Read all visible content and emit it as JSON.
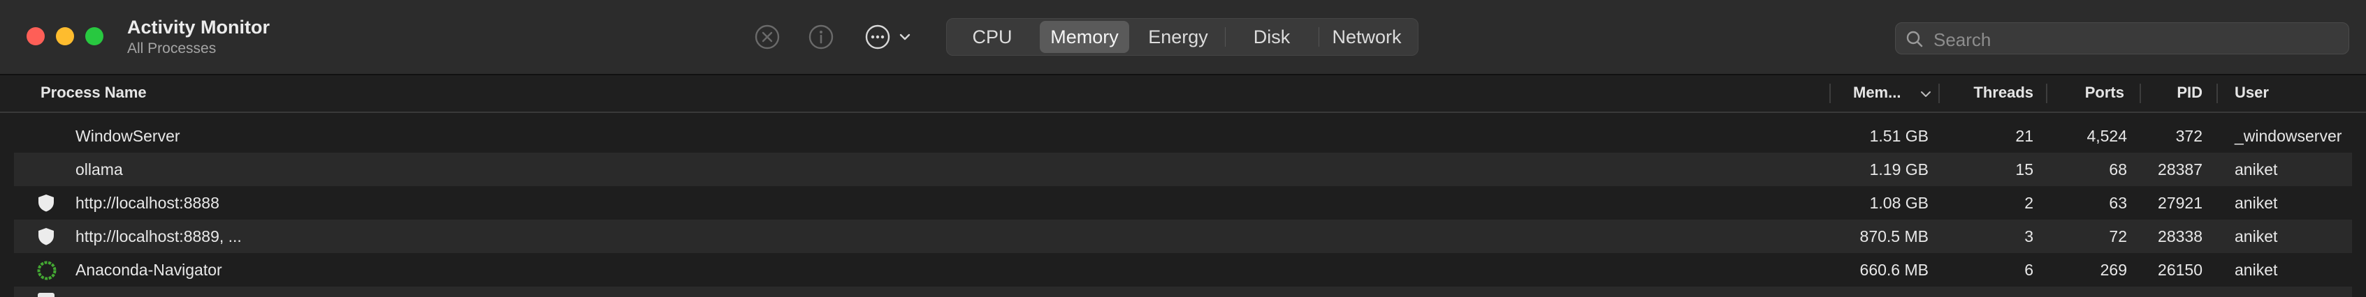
{
  "window": {
    "title": "Activity Monitor",
    "subtitle": "All Processes"
  },
  "toolbar": {
    "stop_icon": "stop-process-icon",
    "info_icon": "info-icon",
    "more_icon": "ellipsis-icon",
    "tabs": [
      {
        "label": "CPU",
        "active": false
      },
      {
        "label": "Memory",
        "active": true
      },
      {
        "label": "Energy",
        "active": false
      },
      {
        "label": "Disk",
        "active": false
      },
      {
        "label": "Network",
        "active": false
      }
    ],
    "search_placeholder": "Search"
  },
  "table": {
    "columns": {
      "name": "Process Name",
      "memory": "Mem...",
      "threads": "Threads",
      "ports": "Ports",
      "pid": "PID",
      "user": "User"
    },
    "sort_column": "memory",
    "rows": [
      {
        "name": "WindowServer",
        "icon": "none",
        "memory": "1.51 GB",
        "threads": "21",
        "ports": "4,524",
        "pid": "372",
        "user": "_windowserver"
      },
      {
        "name": "ollama",
        "icon": "none",
        "memory": "1.19 GB",
        "threads": "15",
        "ports": "68",
        "pid": "28387",
        "user": "aniket"
      },
      {
        "name": "http://localhost:8888",
        "icon": "shield-icon",
        "memory": "1.08 GB",
        "threads": "2",
        "ports": "63",
        "pid": "27921",
        "user": "aniket"
      },
      {
        "name": "http://localhost:8889, ...",
        "icon": "shield-icon",
        "memory": "870.5 MB",
        "threads": "3",
        "ports": "72",
        "pid": "28338",
        "user": "aniket"
      },
      {
        "name": "Anaconda-Navigator",
        "icon": "anaconda-ring-icon",
        "memory": "660.6 MB",
        "threads": "6",
        "ports": "269",
        "pid": "26150",
        "user": "aniket"
      }
    ]
  },
  "colors": {
    "close": "#fe5f57",
    "minimize": "#febc2e",
    "zoom": "#28c840",
    "anaconda": "#44a833"
  }
}
